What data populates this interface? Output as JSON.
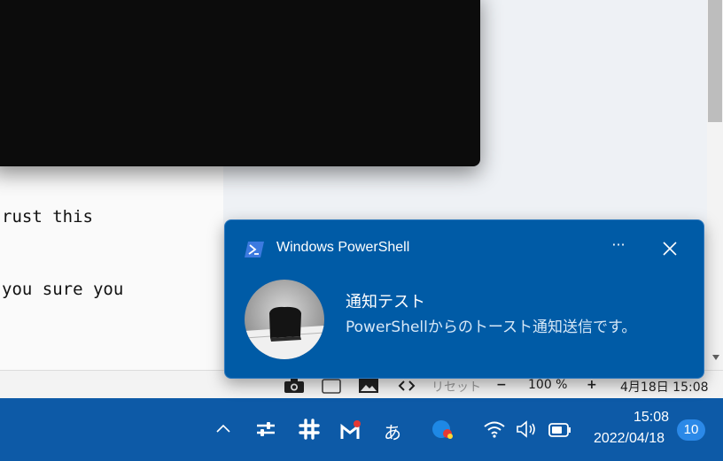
{
  "document": {
    "line1": "rust this",
    "line2": "you sure you"
  },
  "statusbar": {
    "reset": "リセット",
    "minus": "−",
    "zoom": "100 %",
    "plus": "+",
    "datetime": "4月18日  15:08"
  },
  "toast": {
    "app_name": "Windows PowerShell",
    "more_label": "···",
    "title": "通知テスト",
    "body": "PowerShellからのトースト通知送信です。"
  },
  "taskbar": {
    "ime_label": "あ",
    "time": "15:08",
    "date": "2022/04/18",
    "notification_count": "10"
  },
  "colors": {
    "toast_bg": "#005ba6",
    "taskbar_bg": "#0d5aa7",
    "badge_bg": "#2b89e8"
  }
}
